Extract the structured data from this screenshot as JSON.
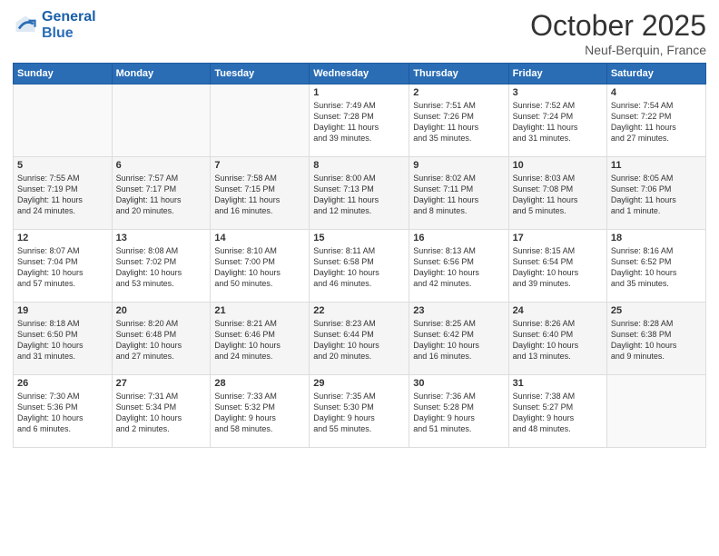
{
  "header": {
    "logo_line1": "General",
    "logo_line2": "Blue",
    "month": "October 2025",
    "location": "Neuf-Berquin, France"
  },
  "weekdays": [
    "Sunday",
    "Monday",
    "Tuesday",
    "Wednesday",
    "Thursday",
    "Friday",
    "Saturday"
  ],
  "weeks": [
    [
      {
        "day": "",
        "info": ""
      },
      {
        "day": "",
        "info": ""
      },
      {
        "day": "",
        "info": ""
      },
      {
        "day": "1",
        "info": "Sunrise: 7:49 AM\nSunset: 7:28 PM\nDaylight: 11 hours\nand 39 minutes."
      },
      {
        "day": "2",
        "info": "Sunrise: 7:51 AM\nSunset: 7:26 PM\nDaylight: 11 hours\nand 35 minutes."
      },
      {
        "day": "3",
        "info": "Sunrise: 7:52 AM\nSunset: 7:24 PM\nDaylight: 11 hours\nand 31 minutes."
      },
      {
        "day": "4",
        "info": "Sunrise: 7:54 AM\nSunset: 7:22 PM\nDaylight: 11 hours\nand 27 minutes."
      }
    ],
    [
      {
        "day": "5",
        "info": "Sunrise: 7:55 AM\nSunset: 7:19 PM\nDaylight: 11 hours\nand 24 minutes."
      },
      {
        "day": "6",
        "info": "Sunrise: 7:57 AM\nSunset: 7:17 PM\nDaylight: 11 hours\nand 20 minutes."
      },
      {
        "day": "7",
        "info": "Sunrise: 7:58 AM\nSunset: 7:15 PM\nDaylight: 11 hours\nand 16 minutes."
      },
      {
        "day": "8",
        "info": "Sunrise: 8:00 AM\nSunset: 7:13 PM\nDaylight: 11 hours\nand 12 minutes."
      },
      {
        "day": "9",
        "info": "Sunrise: 8:02 AM\nSunset: 7:11 PM\nDaylight: 11 hours\nand 8 minutes."
      },
      {
        "day": "10",
        "info": "Sunrise: 8:03 AM\nSunset: 7:08 PM\nDaylight: 11 hours\nand 5 minutes."
      },
      {
        "day": "11",
        "info": "Sunrise: 8:05 AM\nSunset: 7:06 PM\nDaylight: 11 hours\nand 1 minute."
      }
    ],
    [
      {
        "day": "12",
        "info": "Sunrise: 8:07 AM\nSunset: 7:04 PM\nDaylight: 10 hours\nand 57 minutes."
      },
      {
        "day": "13",
        "info": "Sunrise: 8:08 AM\nSunset: 7:02 PM\nDaylight: 10 hours\nand 53 minutes."
      },
      {
        "day": "14",
        "info": "Sunrise: 8:10 AM\nSunset: 7:00 PM\nDaylight: 10 hours\nand 50 minutes."
      },
      {
        "day": "15",
        "info": "Sunrise: 8:11 AM\nSunset: 6:58 PM\nDaylight: 10 hours\nand 46 minutes."
      },
      {
        "day": "16",
        "info": "Sunrise: 8:13 AM\nSunset: 6:56 PM\nDaylight: 10 hours\nand 42 minutes."
      },
      {
        "day": "17",
        "info": "Sunrise: 8:15 AM\nSunset: 6:54 PM\nDaylight: 10 hours\nand 39 minutes."
      },
      {
        "day": "18",
        "info": "Sunrise: 8:16 AM\nSunset: 6:52 PM\nDaylight: 10 hours\nand 35 minutes."
      }
    ],
    [
      {
        "day": "19",
        "info": "Sunrise: 8:18 AM\nSunset: 6:50 PM\nDaylight: 10 hours\nand 31 minutes."
      },
      {
        "day": "20",
        "info": "Sunrise: 8:20 AM\nSunset: 6:48 PM\nDaylight: 10 hours\nand 27 minutes."
      },
      {
        "day": "21",
        "info": "Sunrise: 8:21 AM\nSunset: 6:46 PM\nDaylight: 10 hours\nand 24 minutes."
      },
      {
        "day": "22",
        "info": "Sunrise: 8:23 AM\nSunset: 6:44 PM\nDaylight: 10 hours\nand 20 minutes."
      },
      {
        "day": "23",
        "info": "Sunrise: 8:25 AM\nSunset: 6:42 PM\nDaylight: 10 hours\nand 16 minutes."
      },
      {
        "day": "24",
        "info": "Sunrise: 8:26 AM\nSunset: 6:40 PM\nDaylight: 10 hours\nand 13 minutes."
      },
      {
        "day": "25",
        "info": "Sunrise: 8:28 AM\nSunset: 6:38 PM\nDaylight: 10 hours\nand 9 minutes."
      }
    ],
    [
      {
        "day": "26",
        "info": "Sunrise: 7:30 AM\nSunset: 5:36 PM\nDaylight: 10 hours\nand 6 minutes."
      },
      {
        "day": "27",
        "info": "Sunrise: 7:31 AM\nSunset: 5:34 PM\nDaylight: 10 hours\nand 2 minutes."
      },
      {
        "day": "28",
        "info": "Sunrise: 7:33 AM\nSunset: 5:32 PM\nDaylight: 9 hours\nand 58 minutes."
      },
      {
        "day": "29",
        "info": "Sunrise: 7:35 AM\nSunset: 5:30 PM\nDaylight: 9 hours\nand 55 minutes."
      },
      {
        "day": "30",
        "info": "Sunrise: 7:36 AM\nSunset: 5:28 PM\nDaylight: 9 hours\nand 51 minutes."
      },
      {
        "day": "31",
        "info": "Sunrise: 7:38 AM\nSunset: 5:27 PM\nDaylight: 9 hours\nand 48 minutes."
      },
      {
        "day": "",
        "info": ""
      }
    ]
  ]
}
